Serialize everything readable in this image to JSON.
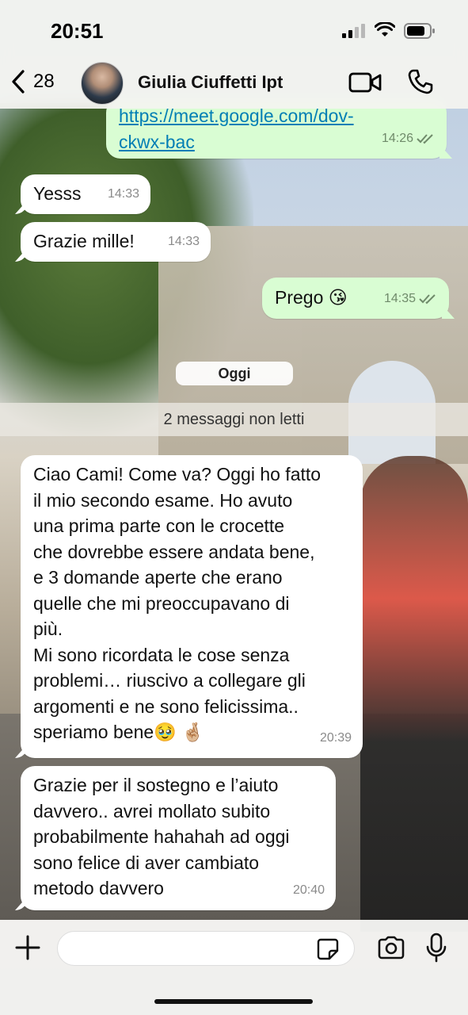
{
  "status_bar": {
    "time": "20:51"
  },
  "header": {
    "back_count": "28",
    "contact_name": "Giulia Ciuffetti Ipt"
  },
  "messages": [
    {
      "direction": "out",
      "text_line1": "https://meet.google.com/dov-",
      "text_line2": "ckwx-bac",
      "time": "14:26"
    },
    {
      "direction": "in",
      "text": "Yesss",
      "time": "14:33"
    },
    {
      "direction": "in",
      "text": "Grazie mille!",
      "time": "14:33"
    },
    {
      "direction": "out",
      "text": "Prego 😘",
      "time": "14:35"
    },
    {
      "direction": "in",
      "lines": [
        "Ciao Cami! Come va? Oggi ho fatto",
        "il mio secondo esame. Ho avuto",
        "una prima parte con le crocette",
        "che dovrebbe essere andata bene,",
        "e 3 domande aperte che erano",
        "quelle che mi preoccupavano di",
        "più.",
        "Mi sono ricordata le cose senza",
        "problemi… riuscivo a collegare gli",
        "argomenti e ne sono felicissima..",
        "speriamo bene🥹 🤞🏼"
      ],
      "time": "20:39"
    },
    {
      "direction": "in",
      "lines": [
        "Grazie per il sostegno e l’aiuto",
        "davvero.. avrei mollato subito",
        "probabilmente hahahah ad oggi",
        "sono felice di aver cambiato",
        "metodo davvero"
      ],
      "time": "20:40"
    }
  ],
  "date_chip": "Oggi",
  "unread_banner": "2 messaggi non letti",
  "input": {
    "value": "",
    "placeholder": ""
  },
  "icons": {
    "back": "chevron-left-icon",
    "video": "video-camera-icon",
    "call": "phone-icon",
    "plus": "plus-icon",
    "sticker": "sticker-icon",
    "camera": "camera-icon",
    "mic": "microphone-icon"
  },
  "colors": {
    "outgoing_bubble": "#d9fdd3",
    "incoming_bubble": "#ffffff",
    "link": "#027eb5"
  }
}
